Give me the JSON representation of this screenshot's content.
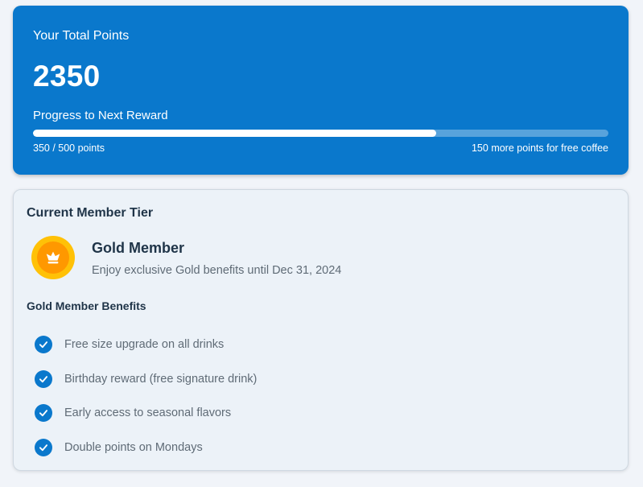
{
  "points": {
    "label": "Your Total Points",
    "value": "2350",
    "progress_label": "Progress to Next Reward",
    "progress_count": "350 / 500 points",
    "progress_current": 350,
    "progress_target": 500,
    "progress_remaining": "150 more points for free coffee"
  },
  "tier": {
    "heading": "Current Member Tier",
    "badge_icon": "crown-icon",
    "name": "Gold Member",
    "description": "Enjoy exclusive Gold benefits until Dec 31, 2024",
    "benefits_heading": "Gold Member Benefits",
    "benefits": [
      "Free size upgrade on all drinks",
      "Birthday reward (free signature drink)",
      "Early access to seasonal flavors",
      "Double points on Mondays"
    ]
  },
  "colors": {
    "accent": "#0a78cc",
    "badge_outer": "#ffc107",
    "badge_inner": "#ff9800",
    "page_background": "#f1f4f9",
    "tier_background": "#ecf2f8"
  }
}
